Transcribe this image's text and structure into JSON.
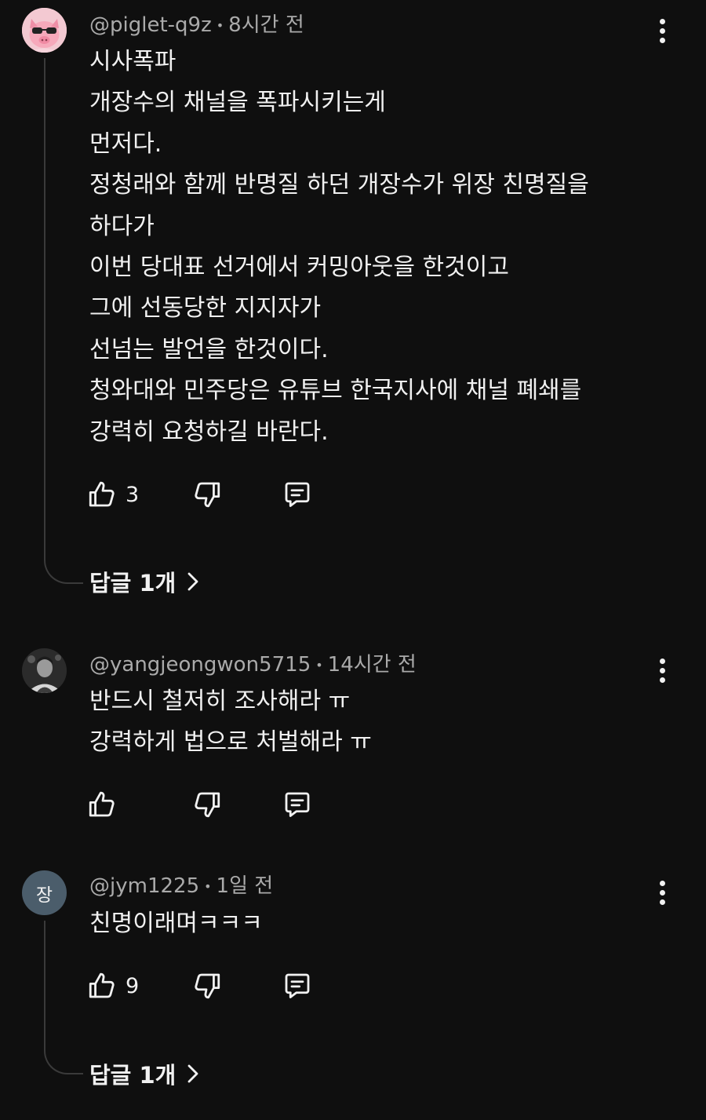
{
  "comments": [
    {
      "handle": "@piglet-q9z",
      "time": "8시간 전",
      "lines": [
        "시사폭파",
        "개장수의 채널을 폭파시키는게",
        "먼저다.",
        "정청래와 함께 반명질 하던 개장수가 위장 친명질을",
        "하다가",
        "이번 당대표 선거에서 커밍아웃을 한것이고",
        "그에 선동당한 지지자가",
        "선넘는 발언을 한것이다.",
        "청와대와 민주당은 유튜브 한국지사에 채널 폐쇄를",
        "강력히 요청하길 바란다."
      ],
      "like_count": "3",
      "replies_label": "답글 1개"
    },
    {
      "handle": "@yangjeongwon5715",
      "time": "14시간 전",
      "lines": [
        "반드시 철저히 조사해라  ㅠ",
        "강력하게 법으로 처벌해라  ㅠ"
      ],
      "like_count": ""
    },
    {
      "handle": "@jym1225",
      "time": "1일 전",
      "avatar_letter": "장",
      "lines": [
        "친명이래며ㅋㅋㅋ"
      ],
      "like_count": "9",
      "replies_label": "답글 1개"
    }
  ],
  "colors": {
    "background": "#0f0f0f",
    "text": "#f1f1f1",
    "meta": "#aaaaaa",
    "thread_line": "#3a3a3a",
    "letter_avatar": "#4b5d6b"
  },
  "icons": [
    "thumbs-up-icon",
    "thumbs-down-icon",
    "reply-comment-icon",
    "more-vert-icon",
    "chevron-right-icon"
  ]
}
